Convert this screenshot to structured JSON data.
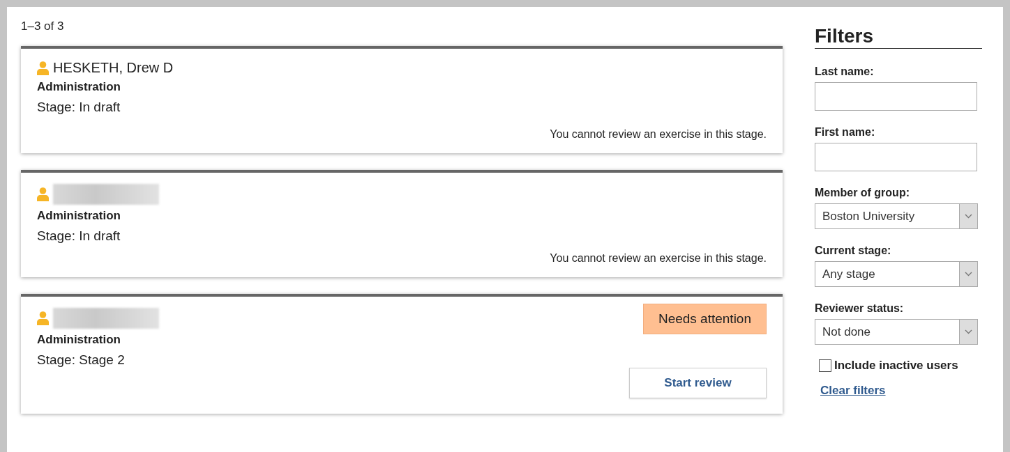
{
  "results_count": "1–3 of 3",
  "cards": [
    {
      "name": "HESKETH, Drew D",
      "name_blurred": false,
      "department": "Administration",
      "stage": "Stage: In draft",
      "note": "You cannot review an exercise in this stage."
    },
    {
      "name_blurred": true,
      "department": "Administration",
      "stage": "Stage: In draft",
      "note": "You cannot review an exercise in this stage."
    },
    {
      "name_blurred": true,
      "department": "Administration",
      "stage": "Stage: Stage 2",
      "badge": "Needs attention",
      "action": "Start review"
    }
  ],
  "filters": {
    "title": "Filters",
    "fields": [
      {
        "kind": "text",
        "label": "Last name:"
      },
      {
        "kind": "text",
        "label": "First name:"
      },
      {
        "kind": "select",
        "label": "Member of group:",
        "value": "Boston University"
      },
      {
        "kind": "select",
        "label": "Current stage:",
        "value": "Any stage"
      },
      {
        "kind": "select",
        "label": "Reviewer status:",
        "value": "Not done"
      }
    ],
    "checkbox": {
      "label": "Include inactive users",
      "checked": false
    },
    "link": "Clear filters"
  }
}
